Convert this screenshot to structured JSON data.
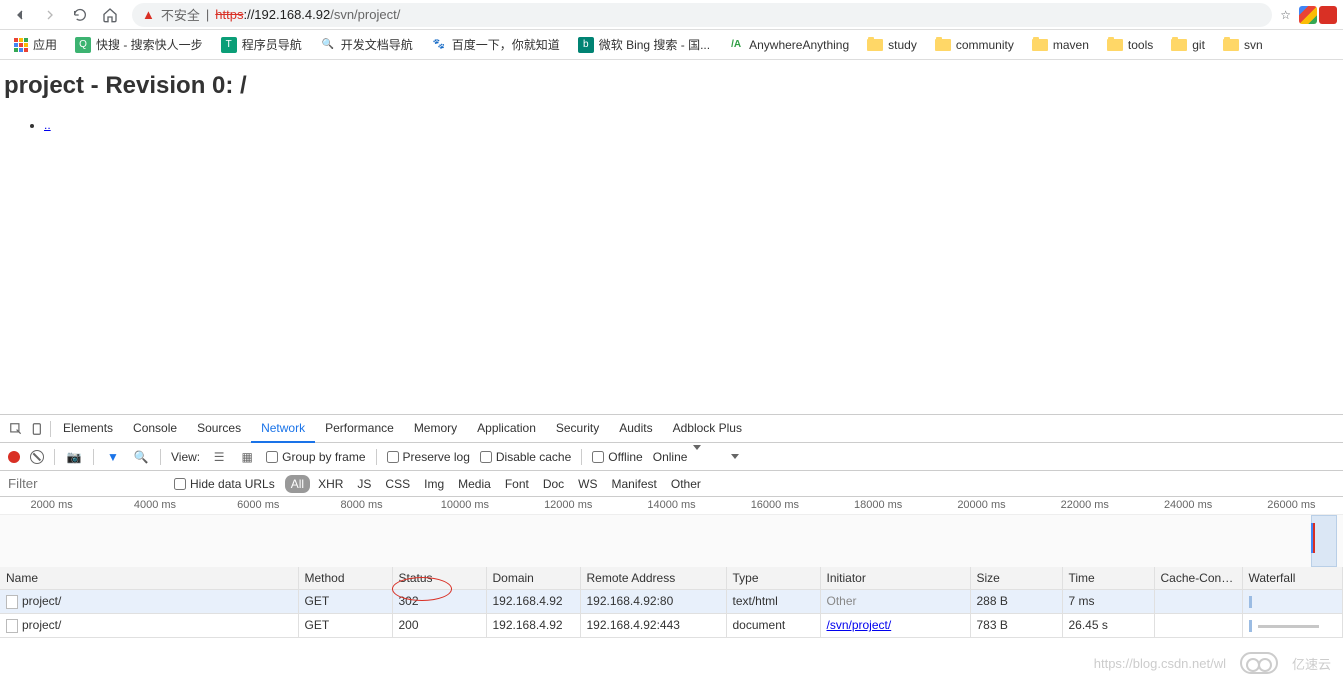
{
  "nav": {
    "insecure_label": "不安全",
    "proto": "https",
    "url_host": "://192.168.4.92",
    "url_path": "/svn/project/"
  },
  "bookmarks": [
    {
      "label": "应用",
      "ico": "apps"
    },
    {
      "label": "快搜 - 搜索快人一步",
      "ico": "green"
    },
    {
      "label": "程序员导航",
      "ico": "teal"
    },
    {
      "label": "开发文档导航",
      "ico": "mag"
    },
    {
      "label": "百度一下，你就知道",
      "ico": "paw"
    },
    {
      "label": "微软 Bing 搜索 - 国...",
      "ico": "bing"
    },
    {
      "label": "AnywhereAnything",
      "ico": "aa"
    },
    {
      "label": "study",
      "ico": "folder"
    },
    {
      "label": "community",
      "ico": "folder"
    },
    {
      "label": "maven",
      "ico": "folder"
    },
    {
      "label": "tools",
      "ico": "folder"
    },
    {
      "label": "git",
      "ico": "folder"
    },
    {
      "label": "svn",
      "ico": "folder"
    }
  ],
  "page": {
    "heading": "project - Revision 0: /",
    "link": ".."
  },
  "devtools": {
    "tabs": [
      "Elements",
      "Console",
      "Sources",
      "Network",
      "Performance",
      "Memory",
      "Application",
      "Security",
      "Audits",
      "Adblock Plus"
    ],
    "active_tab": "Network",
    "toolbar": {
      "view_label": "View:",
      "group": "Group by frame",
      "preserve": "Preserve log",
      "disable": "Disable cache",
      "offline": "Offline",
      "online": "Online"
    },
    "filter": {
      "placeholder": "Filter",
      "hide": "Hide data URLs",
      "types": [
        "All",
        "XHR",
        "JS",
        "CSS",
        "Img",
        "Media",
        "Font",
        "Doc",
        "WS",
        "Manifest",
        "Other"
      ]
    },
    "ticks": [
      "2000 ms",
      "4000 ms",
      "6000 ms",
      "8000 ms",
      "10000 ms",
      "12000 ms",
      "14000 ms",
      "16000 ms",
      "18000 ms",
      "20000 ms",
      "22000 ms",
      "24000 ms",
      "26000 ms"
    ],
    "cols": [
      "Name",
      "Method",
      "Status",
      "Domain",
      "Remote Address",
      "Type",
      "Initiator",
      "Size",
      "Time",
      "Cache-Control",
      "Waterfall"
    ],
    "rows": [
      {
        "name": "project/",
        "method": "GET",
        "status": "302",
        "domain": "192.168.4.92",
        "remote": "192.168.4.92:80",
        "type": "text/html",
        "initiator": "Other",
        "initiator_link": false,
        "size": "288 B",
        "time": "7 ms",
        "cache": "",
        "sel": true,
        "wf": "short"
      },
      {
        "name": "project/",
        "method": "GET",
        "status": "200",
        "domain": "192.168.4.92",
        "remote": "192.168.4.92:443",
        "type": "document",
        "initiator": "/svn/project/",
        "initiator_link": true,
        "size": "783 B",
        "time": "26.45 s",
        "cache": "",
        "sel": false,
        "wf": "long"
      }
    ]
  },
  "watermark": {
    "url": "https://blog.csdn.net/wl",
    "brand": "亿速云"
  }
}
